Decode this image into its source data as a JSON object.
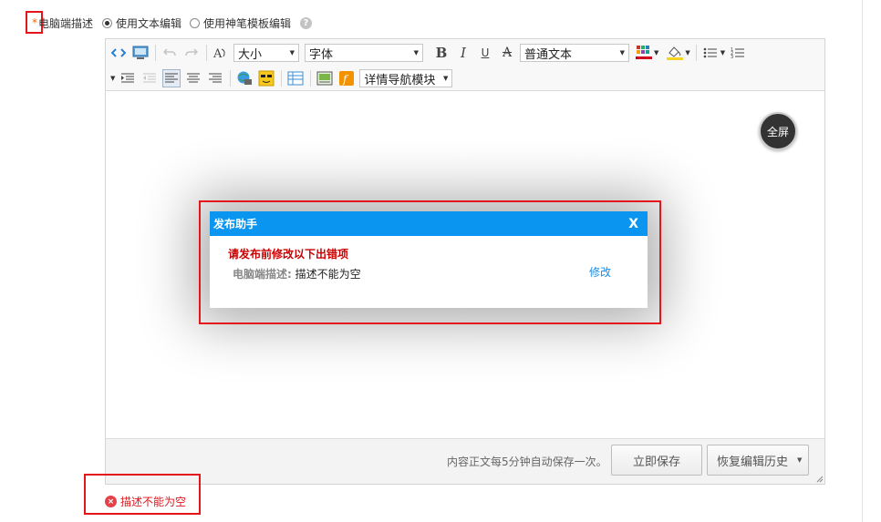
{
  "field": {
    "required_mark": "*",
    "label": "电脑端描述",
    "options": [
      {
        "label": "使用文本编辑",
        "selected": true
      },
      {
        "label": "使用神笔模板编辑",
        "selected": false
      }
    ],
    "help_icon_glyph": "?"
  },
  "toolbar": {
    "size_label": "大小",
    "font_label": "字体",
    "bold_glyph": "B",
    "italic_glyph": "I",
    "underline_glyph": "U",
    "strike_glyph": "A",
    "style_label": "普通文本",
    "detail_nav_label": "详情导航模块"
  },
  "editor": {
    "fullscreen_label": "全屏",
    "autosave_text": "内容正文每5分钟自动保存一次。",
    "save_button": "立即保存",
    "history_button": "恢复编辑历史"
  },
  "modal": {
    "title": "发布助手",
    "close_label": "X",
    "error_title": "请发布前修改以下出错项",
    "error_field": "电脑端描述:",
    "error_message": "描述不能为空",
    "fix_link": "修改"
  },
  "bottom_error": {
    "icon_glyph": "×",
    "message": "描述不能为空"
  },
  "colors": {
    "modal_header": "#0a96f0",
    "error_red": "#cc0000",
    "highlight_red": "#e4161c",
    "link_blue": "#1a8ae8"
  }
}
